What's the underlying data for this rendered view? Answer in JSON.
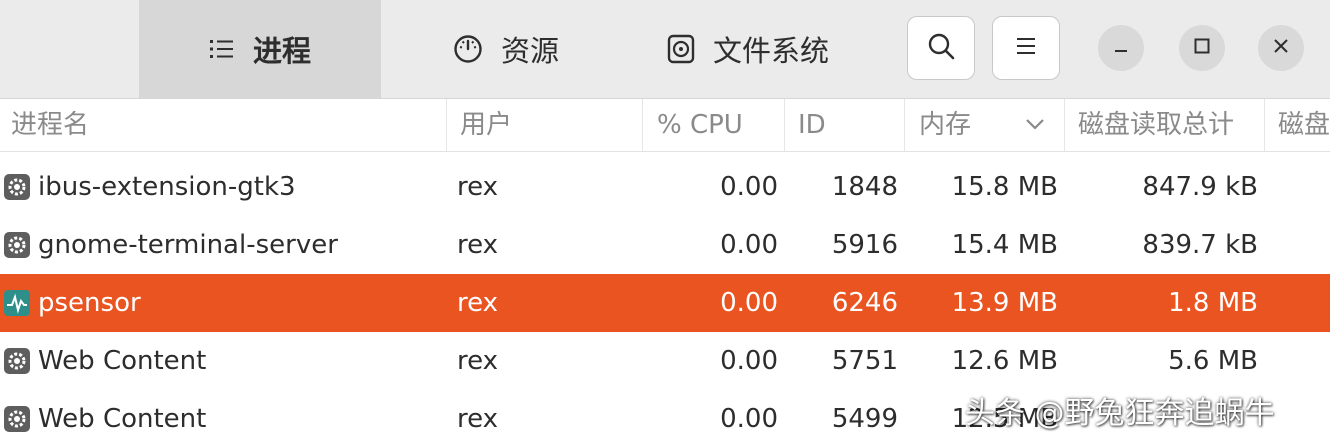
{
  "colors": {
    "headerbar_bg": "#ebebeb",
    "active_tab_bg": "#d7d7d7",
    "selection_accent": "#e95420",
    "header_text": "#8a8a8a",
    "row_text": "#2d2d2d"
  },
  "header": {
    "tabs": [
      {
        "label": "进程",
        "icon": "list-icon",
        "active": true
      },
      {
        "label": "资源",
        "icon": "gauge-icon",
        "active": false
      },
      {
        "label": "文件系统",
        "icon": "disk-icon",
        "active": false
      }
    ],
    "buttons": {
      "search": "search-icon",
      "menu": "hamburger-menu-icon",
      "minimize": "minimize-icon",
      "maximize": "maximize-icon",
      "close": "close-icon"
    }
  },
  "table": {
    "columns": [
      "进程名",
      "用户",
      "% CPU",
      "ID",
      "内存",
      "磁盘读取总计",
      "磁盘"
    ],
    "sort_column": "内存",
    "sort_direction": "descending",
    "rows": [
      {
        "name": "ibus-extension-gtk3",
        "user": "rex",
        "cpu": "0.00",
        "id": "1848",
        "memory": "15.8 MB",
        "disk_read": "847.9 kB",
        "icon": "gear-icon",
        "selected": false
      },
      {
        "name": "gnome-terminal-server",
        "user": "rex",
        "cpu": "0.00",
        "id": "5916",
        "memory": "15.4 MB",
        "disk_read": "839.7 kB",
        "icon": "gear-icon",
        "selected": false
      },
      {
        "name": "psensor",
        "user": "rex",
        "cpu": "0.00",
        "id": "6246",
        "memory": "13.9 MB",
        "disk_read": "1.8 MB",
        "icon": "sensor-graph-icon",
        "selected": true
      },
      {
        "name": "Web Content",
        "user": "rex",
        "cpu": "0.00",
        "id": "5751",
        "memory": "12.6 MB",
        "disk_read": "5.6 MB",
        "icon": "gear-icon",
        "selected": false
      },
      {
        "name": "Web Content",
        "user": "rex",
        "cpu": "0.00",
        "id": "5499",
        "memory": "12.5 MB",
        "disk_read": "",
        "icon": "gear-icon",
        "selected": false
      }
    ]
  },
  "watermark": "头条 @野兔狂奔追蜗牛"
}
